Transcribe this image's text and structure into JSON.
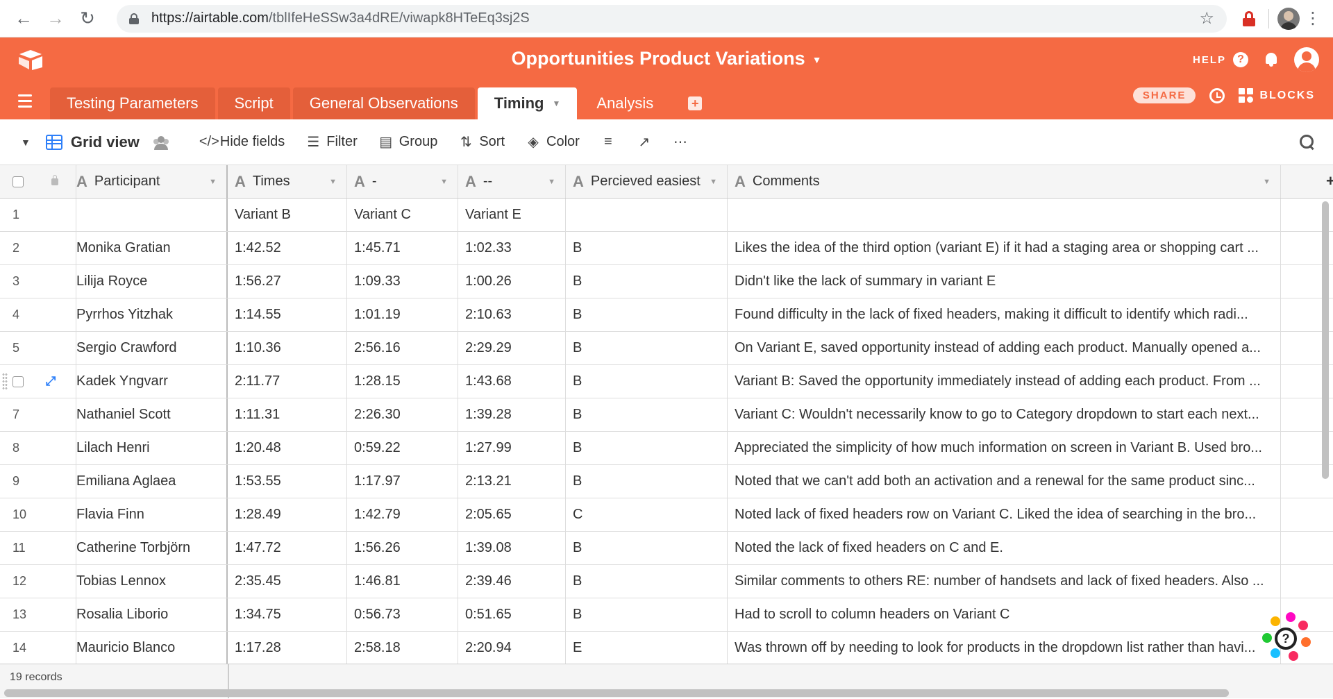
{
  "browser": {
    "url_host": "https://airtable.com",
    "url_path": "/tblIfeHeSSw3a4dRE/viwapk8HTeEq3sj2S"
  },
  "app": {
    "base_title": "Opportunities Product Variations",
    "help_label": "HELP",
    "share_label": "SHARE",
    "blocks_label": "BLOCKS",
    "accent_color": "#f56a43",
    "tabs": [
      {
        "label": "Testing Parameters",
        "active": false
      },
      {
        "label": "Script",
        "active": false
      },
      {
        "label": "General Observations",
        "active": false
      },
      {
        "label": "Timing",
        "active": true
      },
      {
        "label": "Analysis",
        "active": false
      }
    ]
  },
  "toolbar": {
    "view_name": "Grid view",
    "hide_fields": "Hide fields",
    "filter": "Filter",
    "group": "Group",
    "sort": "Sort",
    "color": "Color"
  },
  "grid": {
    "columns": [
      "Participant",
      "Times",
      "-",
      "--",
      "Percieved easiest",
      "Comments"
    ],
    "rows": [
      {
        "id": "1",
        "participant": "",
        "times": "Variant B",
        "v1": "Variant C",
        "v2": "Variant E",
        "easiest": "",
        "comments": ""
      },
      {
        "id": "2",
        "participant": "Monika Gratian",
        "times": "1:42.52",
        "v1": "1:45.71",
        "v2": "1:02.33",
        "easiest": "B",
        "comments": "Likes the idea of the third option (variant E) if it had a staging area or shopping cart ..."
      },
      {
        "id": "3",
        "participant": "Lilija Royce",
        "times": "1:56.27",
        "v1": "1:09.33",
        "v2": "1:00.26",
        "easiest": "B",
        "comments": "Didn't like the lack of summary in variant E"
      },
      {
        "id": "4",
        "participant": "Pyrrhos Yitzhak",
        "times": "1:14.55",
        "v1": "1:01.19",
        "v2": "2:10.63",
        "easiest": "B",
        "comments": "Found difficulty in the lack of fixed headers, making it difficult to identify which radi..."
      },
      {
        "id": "5",
        "participant": "Sergio Crawford",
        "times": "1:10.36",
        "v1": "2:56.16",
        "v2": "2:29.29",
        "easiest": "B",
        "comments": "On Variant E, saved opportunity instead of adding each product. Manually opened a..."
      },
      {
        "id": "",
        "participant": "Kadek Yngvarr",
        "times": "2:11.77",
        "v1": "1:28.15",
        "v2": "1:43.68",
        "easiest": "B",
        "comments": "Variant B: Saved the opportunity immediately instead of adding each product. From ...",
        "hovered": true
      },
      {
        "id": "7",
        "participant": "Nathaniel Scott",
        "times": "1:11.31",
        "v1": "2:26.30",
        "v2": "1:39.28",
        "easiest": "B",
        "comments": "Variant C: Wouldn't necessarily know to go to Category dropdown to start each next..."
      },
      {
        "id": "8",
        "participant": "Lilach Henri",
        "times": "1:20.48",
        "v1": "0:59.22",
        "v2": "1:27.99",
        "easiest": "B",
        "comments": "Appreciated the simplicity of how much information on screen in Variant B. Used bro..."
      },
      {
        "id": "9",
        "participant": "Emiliana Aglaea",
        "times": "1:53.55",
        "v1": "1:17.97",
        "v2": "2:13.21",
        "easiest": "B",
        "comments": "Noted that we can't add both an activation and a renewal for the same product sinc..."
      },
      {
        "id": "10",
        "participant": "Flavia Finn",
        "times": "1:28.49",
        "v1": "1:42.79",
        "v2": "2:05.65",
        "easiest": "C",
        "comments": "Noted lack of fixed headers row on Variant C. Liked the idea of searching in the bro..."
      },
      {
        "id": "11",
        "participant": "Catherine Torbjörn",
        "times": "1:47.72",
        "v1": "1:56.26",
        "v2": "1:39.08",
        "easiest": "B",
        "comments": "Noted the lack of fixed headers on C and E."
      },
      {
        "id": "12",
        "participant": "Tobias Lennox",
        "times": "2:35.45",
        "v1": "1:46.81",
        "v2": "2:39.46",
        "easiest": "B",
        "comments": "Similar comments to others RE: number of handsets and lack of fixed headers. Also ..."
      },
      {
        "id": "13",
        "participant": "Rosalia Liborio",
        "times": "1:34.75",
        "v1": "0:56.73",
        "v2": "0:51.65",
        "easiest": "B",
        "comments": "Had to scroll to column headers on Variant C"
      },
      {
        "id": "14",
        "participant": "Mauricio Blanco",
        "times": "1:17.28",
        "v1": "2:58.18",
        "v2": "2:20.94",
        "easiest": "E",
        "comments": "Was thrown off by needing to look for products in the dropdown list rather than havi..."
      }
    ],
    "record_count": "19 records"
  }
}
